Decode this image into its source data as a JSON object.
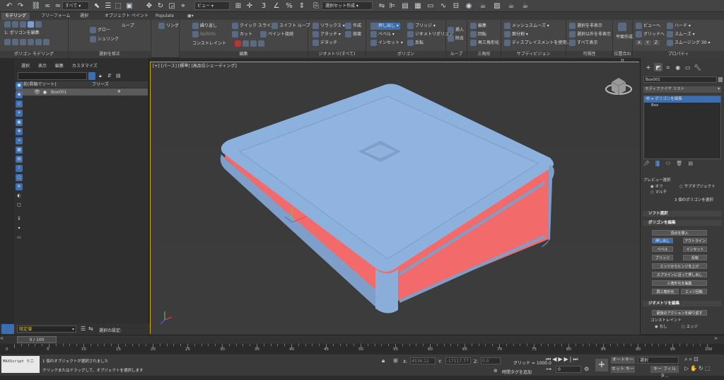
{
  "toolbar": {
    "filter": "すべて",
    "view_dropdown": "ビュー",
    "selection_set": "選択セット作成"
  },
  "tabs": [
    "モデリング",
    "フリーフォーム",
    "選択",
    "オブジェクト ペイント",
    "Populate"
  ],
  "ribbon": {
    "polygon_modeling": {
      "title": "ポリゴン モデリング",
      "item": "1: ポリゴンを編集"
    },
    "modify_selection": {
      "title": "選択を修正",
      "items": [
        "グロー",
        "シュリンク",
        "ループ",
        "リング"
      ]
    },
    "edit": {
      "title": "編集",
      "items": [
        "繰り返し",
        "クイック スライス",
        "スイフト ループ",
        "NURMS",
        "カット",
        "ペイント接続",
        "コンストレイント"
      ]
    },
    "geometry": {
      "title": "ジオメトリ(すべて)",
      "items": [
        "リラックス",
        "作成",
        "アタッチ",
        "崩壊",
        "デタッチ"
      ]
    },
    "polygons": {
      "title": "ポリゴン",
      "items": [
        "押し出し",
        "ブリッジ",
        "ベベル",
        "ジオメトリポリゴン",
        "インセット",
        "反転"
      ]
    },
    "loops": {
      "title": "ループ",
      "items": [
        "挿入",
        "除去"
      ]
    },
    "triangles": {
      "title": "三角形",
      "items": [
        "編集",
        "回転",
        "再三角形化"
      ]
    },
    "subdivision": {
      "title": "サブディビジョン",
      "items": [
        "メッシュスムーズ",
        "面分割",
        "ディスプレイスメントを使用..."
      ]
    },
    "visibility": {
      "title": "可視性",
      "items": [
        "選択を非表示",
        "選択以外を非表示",
        "すべて表示"
      ]
    },
    "align": {
      "title": "位置合わせ",
      "items": [
        "平面作成"
      ]
    },
    "properties": {
      "title": "プロパティ",
      "items": [
        "ビューへ",
        "グリッドへ",
        "X",
        "Y",
        "Z",
        "ハード",
        "スムーズ",
        "スムージング 30"
      ]
    }
  },
  "explorer": {
    "menu": [
      "選択",
      "表示",
      "編集",
      "カスタマイズ"
    ],
    "col_name": "名前(昇順でソート)",
    "col_freeze": "フリーズ",
    "row": "Box001"
  },
  "viewport": {
    "label": "[+] [パース] [標準] [高品位シェーディング]"
  },
  "command_panel": {
    "object_name": "Box001",
    "modifier_list": "モディファイヤ リスト",
    "stack": [
      "ポリゴンを編集",
      "Box"
    ],
    "preview_select": "プレビュー選択",
    "preview_options": [
      "オフ",
      "サブオブジェクト",
      "マルチ"
    ],
    "selected_info": "3 個のポリゴンを選択",
    "soft_selection": "ソフト選択",
    "edit_polygons": "ポリゴンを編集",
    "insert_vertex": "頂点を挿入",
    "buttons": [
      "押し出し",
      "アウトライン",
      "ベベル",
      "インセット",
      "ブリッジ",
      "反転",
      "エッジからヒンジを上げ",
      "スプラインに沿って押し出し",
      "三角形化を編集",
      "再三角形化",
      "エッジ回転"
    ],
    "edit_geometry": "ジオメトリを編集",
    "repeat_last": "最後のアクションを繰り返す",
    "constraint": "コンストレイント",
    "constraint_opts": [
      "なし",
      "エッジ"
    ]
  },
  "status": {
    "mode": "既定値",
    "selection_settings": "選択の設定:",
    "time": "0 / 100",
    "maxscript": "MAXScript ミニ",
    "msg1": "1 個のオブジェクトが選択されました",
    "msg2": "クリックまたはドラッグして、オブジェクトを選択します",
    "x_label": "X:",
    "x_val": "4536.12",
    "y_label": "Y:",
    "y_val": "-17117.77",
    "z_label": "Z:",
    "z_val": "0.0",
    "grid": "グリッド = 1000.0",
    "add_time_tag": "時間タグを追加",
    "auto_key": "オートキー",
    "select_label": "選択",
    "set_key": "セット キー",
    "key_filter": "キー フィルタ...",
    "frame": "0"
  },
  "ruler_ticks": [
    "5",
    "10",
    "15",
    "20",
    "25",
    "30",
    "35",
    "40",
    "45",
    "50",
    "55",
    "60",
    "65",
    "70",
    "75",
    "80",
    "85",
    "90",
    "95",
    "100"
  ]
}
